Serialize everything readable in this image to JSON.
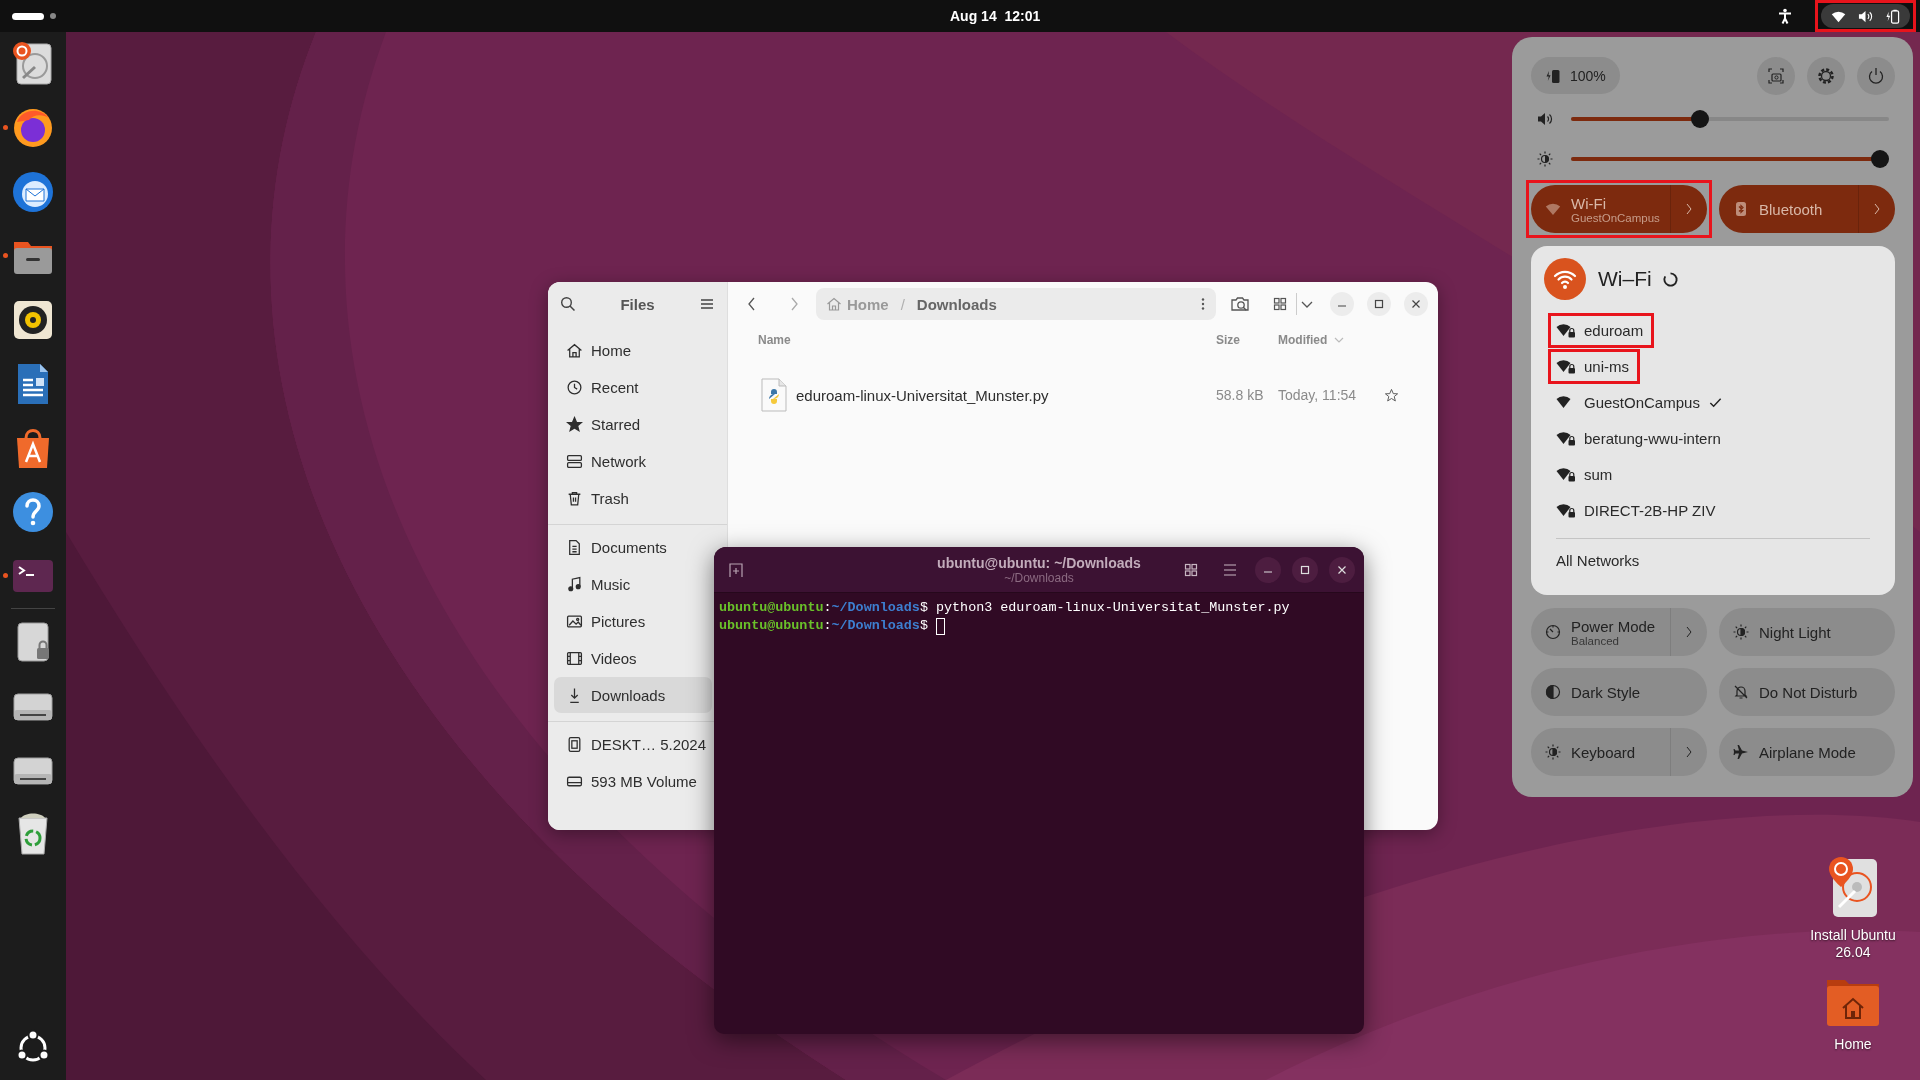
{
  "top_bar": {
    "clock": "Aug 14  12:01",
    "status_highlighted": true
  },
  "dock": {
    "apps": [
      {
        "kind": "installer",
        "running": false
      },
      {
        "kind": "firefox",
        "running": true
      },
      {
        "kind": "thunderbird",
        "running": false
      },
      {
        "kind": "files",
        "running": true
      },
      {
        "kind": "rhythmbox",
        "running": false
      },
      {
        "kind": "writer",
        "running": false
      },
      {
        "kind": "appcenter",
        "running": false
      },
      {
        "kind": "help",
        "running": false
      },
      {
        "kind": "terminal",
        "running": true
      }
    ],
    "devices": [
      {
        "kind": "ssd"
      },
      {
        "kind": "drive"
      },
      {
        "kind": "drive"
      },
      {
        "kind": "trash"
      }
    ]
  },
  "files_window": {
    "title": "Files",
    "sidebar": [
      {
        "items": [
          {
            "label": "Home",
            "kind": "home",
            "selected": false
          },
          {
            "label": "Recent",
            "kind": "recent",
            "selected": false
          },
          {
            "label": "Starred",
            "kind": "starred",
            "selected": false
          },
          {
            "label": "Network",
            "kind": "network",
            "selected": false
          },
          {
            "label": "Trash",
            "kind": "trash",
            "selected": false
          }
        ]
      },
      {
        "items": [
          {
            "label": "Documents",
            "kind": "documents",
            "selected": false
          },
          {
            "label": "Music",
            "kind": "music",
            "selected": false
          },
          {
            "label": "Pictures",
            "kind": "pictures",
            "selected": false
          },
          {
            "label": "Videos",
            "kind": "videos",
            "selected": false
          },
          {
            "label": "Downloads",
            "kind": "downloads",
            "selected": true
          }
        ]
      },
      {
        "items": [
          {
            "label": "DESKT…  5.2024",
            "kind": "sdcard",
            "selected": false
          },
          {
            "label": "593 MB Volume",
            "kind": "drive",
            "selected": false
          }
        ]
      }
    ],
    "path": [
      "Home",
      "Downloads"
    ],
    "path_separator": "/",
    "columns": [
      {
        "label": "Name",
        "sorted": false
      },
      {
        "label": "Size",
        "sorted": false
      },
      {
        "label": "Modified",
        "sorted": true
      }
    ],
    "rows": [
      {
        "name": "eduroam-linux-Universitat_Munster.py",
        "size": "58.8 kB",
        "modified": "Today, 11:54",
        "starred": false
      }
    ]
  },
  "terminal": {
    "title": "ubuntu@ubuntu: ~/Downloads",
    "subtitle": "~/Downloads",
    "lines": [
      {
        "user": "ubuntu@ubuntu",
        "colon": ":",
        "path": "~/Downloads",
        "prompt": "$",
        "command": "python3 eduroam-linux-Universitat_Munster.py",
        "cursor": false
      },
      {
        "user": "ubuntu@ubuntu",
        "colon": ":",
        "path": "~/Downloads",
        "prompt": "$",
        "cursor": true
      }
    ]
  },
  "quick_settings": {
    "battery": "100%",
    "volume": {
      "level": 0.4
    },
    "brightness": {
      "level": 1
    },
    "main_toggles": [
      {
        "kind": "wifi",
        "label": "Wi-Fi",
        "subtitle": "GuestOnCampus",
        "on": true,
        "menu": true,
        "highlighted": true
      },
      {
        "kind": "bluetooth",
        "label": "Bluetooth",
        "on": true,
        "menu": true,
        "highlighted": false
      }
    ],
    "wifi_menu": {
      "title": "Wi–Fi",
      "networks": [
        {
          "name": "eduroam",
          "secured": true,
          "connected": false,
          "highlighted": true
        },
        {
          "name": "uni-ms",
          "secured": true,
          "connected": false,
          "highlighted": true
        },
        {
          "name": "GuestOnCampus",
          "secured": false,
          "connected": true,
          "highlighted": false
        },
        {
          "name": "beratung-wwu-intern",
          "secured": true,
          "connected": false,
          "highlighted": false
        },
        {
          "name": "sum",
          "secured": true,
          "connected": false,
          "highlighted": false
        },
        {
          "name": "DIRECT-2B-HP ZIV",
          "secured": true,
          "connected": false,
          "highlighted": false
        }
      ],
      "footer": "All Networks"
    },
    "toggles": [
      {
        "kind": "power",
        "label": "Power Mode",
        "subtitle": "Balanced",
        "on": false,
        "menu": true
      },
      {
        "kind": "night",
        "label": "Night Light",
        "on": false,
        "menu": false
      },
      {
        "kind": "dark",
        "label": "Dark Style",
        "on": false,
        "menu": false
      },
      {
        "kind": "dnd",
        "label": "Do Not Disturb",
        "on": false,
        "menu": false
      },
      {
        "kind": "keyboard",
        "label": "Keyboard",
        "on": false,
        "menu": true
      },
      {
        "kind": "airplane",
        "label": "Airplane Mode",
        "on": false,
        "menu": false
      }
    ]
  },
  "desktop_icons": [
    {
      "kind": "installer",
      "label": "Install Ubuntu 26.04"
    },
    {
      "kind": "home",
      "label": "Home"
    }
  ]
}
